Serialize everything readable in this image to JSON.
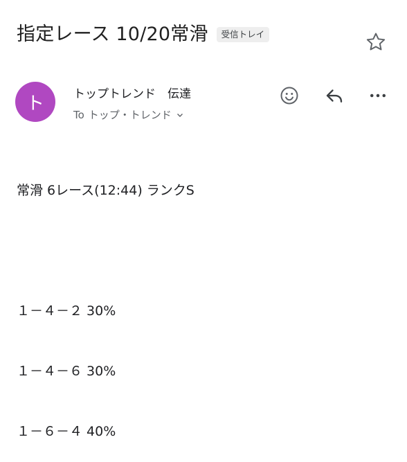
{
  "email": {
    "subject": "指定レース 10/20常滑",
    "label": "受信トレイ",
    "sender": {
      "avatar_letter": "ト",
      "name": "トップトレンド　伝達",
      "to_prefix": "To",
      "to_name": "トップ・トレンド"
    },
    "body": {
      "heading": "常滑 6レース(12:44) ランクS",
      "lines": [
        "１－４－２ 30%",
        "１－４－６ 30%",
        "１－６－４ 40%"
      ]
    }
  },
  "colors": {
    "avatar": "#b048c1",
    "icon": "#5f6368"
  },
  "icons": {
    "star": "star-outline-icon",
    "emoji": "smiley-icon",
    "reply": "reply-icon",
    "more": "more-horizontal-icon",
    "chevron": "chevron-down-icon"
  }
}
